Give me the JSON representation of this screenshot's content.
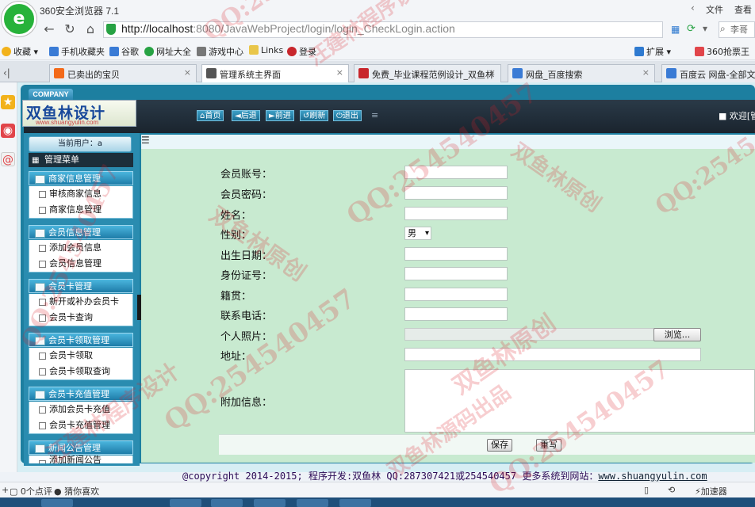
{
  "window": {
    "title": "360安全浏览器 7.1",
    "menu_file": "文件",
    "menu_view": "查看"
  },
  "nav": {
    "url_host": "http://localhost",
    "url_rest": ":8080/JavaWebProject/login/login_CheckLogin.action",
    "search_placeholder": "李哥"
  },
  "bookmarks": [
    {
      "label": "收藏",
      "color": "#f2b21b"
    },
    {
      "label": "手机收藏夹",
      "color": "#3a7bd5"
    },
    {
      "label": "谷歌",
      "color": "#3a7bd5"
    },
    {
      "label": "网址大全",
      "color": "#27a243"
    },
    {
      "label": "游戏中心",
      "color": "#777777"
    },
    {
      "label": "Links",
      "color": "#e9c64a"
    },
    {
      "label": "登录",
      "color": "#c8262c"
    }
  ],
  "bookmarks_right": {
    "extend": "扩展",
    "grab": "360抢票王"
  },
  "tabs": [
    {
      "label": "已卖出的宝贝",
      "color": "#f36a1a"
    },
    {
      "label": "管理系统主界面",
      "color": "#555555"
    },
    {
      "label": "免费_毕业课程范例设计_双鱼林",
      "color": "#c8262c"
    },
    {
      "label": "网盘_百度搜索",
      "color": "#3a7bd5"
    },
    {
      "label": "百度云 网盘-全部文件",
      "color": "#3a7bd5"
    }
  ],
  "header": {
    "company_tag": "COMPANY",
    "brand_cn": "双鱼林设计",
    "brand_en": "www.shuangyulin.com",
    "buttons": [
      {
        "label": "首页",
        "icon": "home-icon"
      },
      {
        "label": "后退",
        "icon": "back-arrow-icon"
      },
      {
        "label": "前进",
        "icon": "forward-arrow-icon"
      },
      {
        "label": "刷新",
        "icon": "refresh-icon"
      },
      {
        "label": "退出",
        "icon": "power-icon"
      }
    ],
    "welcome": "■ 欢迎[管"
  },
  "sidebar": {
    "current_user": "当前用户：a",
    "menu_title": "管理菜单",
    "groups": [
      {
        "title": "商家信息管理",
        "items": [
          "审核商家信息",
          "商家信息管理"
        ]
      },
      {
        "title": "会员信息管理",
        "items": [
          "添加会员信息",
          "会员信息管理"
        ]
      },
      {
        "title": "会员卡管理",
        "items": [
          "新开或补办会员卡",
          "会员卡查询"
        ]
      },
      {
        "title": "会员卡领取管理",
        "items": [
          "会员卡领取",
          "会员卡领取查询"
        ]
      },
      {
        "title": "会员卡充值管理",
        "items": [
          "添加会员卡充值",
          "会员卡充值管理"
        ]
      },
      {
        "title": "新闻公告管理",
        "items": [
          "添加新闻公告"
        ]
      }
    ]
  },
  "form": {
    "fields": [
      {
        "label": "会员账号：",
        "value": ""
      },
      {
        "label": "会员密码：",
        "value": ""
      },
      {
        "label": "姓名：",
        "value": ""
      },
      {
        "label": "性别：",
        "value": "男"
      },
      {
        "label": "出生日期：",
        "value": ""
      },
      {
        "label": "身份证号：",
        "value": ""
      },
      {
        "label": "籍贯：",
        "value": ""
      },
      {
        "label": "联系电话：",
        "value": ""
      },
      {
        "label": "个人照片：",
        "value": ""
      },
      {
        "label": "地址：",
        "value": ""
      },
      {
        "label": "附加信息：",
        "value": ""
      }
    ],
    "browse_label": "浏览...",
    "save_label": "保存",
    "reset_label": "重写"
  },
  "footer": {
    "text": "@copyright 2014-2015; 程序开发:双鱼林  QQ:287307421或254540457  更多系统到网站：",
    "link": "www.shuangyulin.com"
  },
  "status": {
    "likes": "0个点评",
    "guess": "猜你喜欢",
    "accelerator": "加速器"
  },
  "watermark": {
    "qq": "QQ:254540457",
    "orig": "双鱼林原创",
    "lib": "汪建林程序设计",
    "src": "双鱼林源码出品"
  }
}
